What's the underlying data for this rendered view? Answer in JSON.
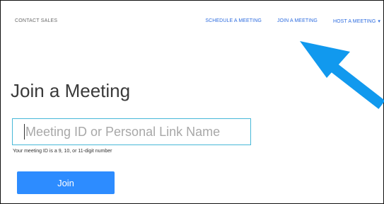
{
  "nav": {
    "contact_sales": "CONTACT SALES",
    "schedule_meeting": "SCHEDULE A MEETING",
    "join_meeting": "JOIN A MEETING",
    "host_meeting": "HOST A MEETING",
    "host_caret_icon": "caret-down-icon"
  },
  "main": {
    "title": "Join a Meeting",
    "input_placeholder": "Meeting ID or Personal Link Name",
    "input_value": "",
    "hint": "Your meeting ID is a 9, 10, or 11-digit number",
    "join_label": "Join"
  },
  "annotation": {
    "arrow_icon": "pointer-arrow-icon",
    "arrow_color": "#1199ee"
  },
  "colors": {
    "link": "#2d6cdf",
    "button": "#2d8cff",
    "input_border": "#47b8d8"
  }
}
